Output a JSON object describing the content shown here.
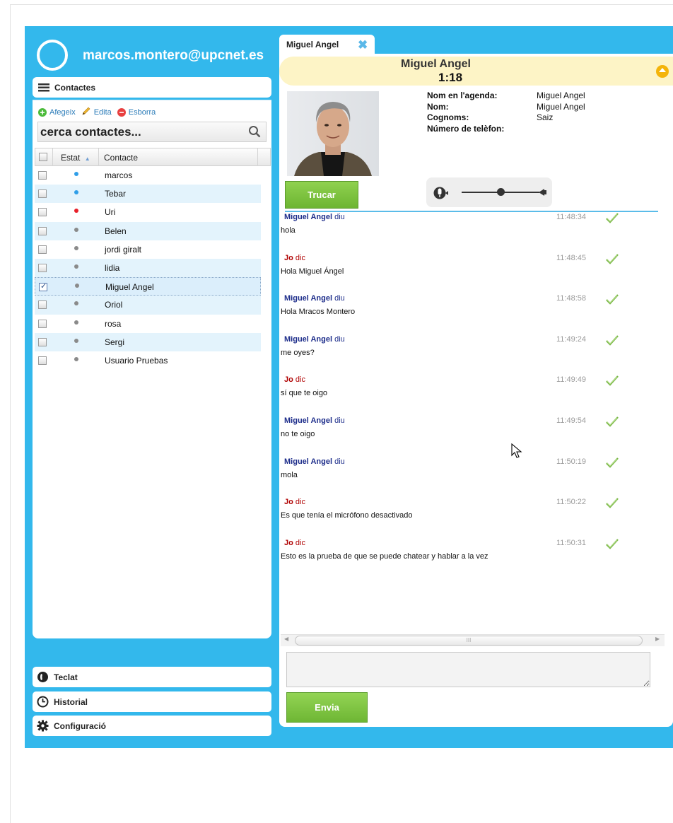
{
  "user": {
    "email": "marcos.montero@upcnet.es"
  },
  "contacts": {
    "header": "Contactes",
    "actions": {
      "add": "Afegeix",
      "edit": "Edita",
      "delete": "Esborra"
    },
    "search_placeholder": "cerca contactes...",
    "columns": {
      "status": "Estat",
      "contact": "Contacte"
    },
    "rows": [
      {
        "name": "marcos",
        "status_color": "#2f9ee8",
        "checked": false
      },
      {
        "name": "Tebar",
        "status_color": "#2f9ee8",
        "checked": false
      },
      {
        "name": "Uri",
        "status_color": "#e8202a",
        "checked": false
      },
      {
        "name": "Belen",
        "status_color": "#8a8a8a",
        "checked": false
      },
      {
        "name": "jordi giralt",
        "status_color": "#8a8a8a",
        "checked": false
      },
      {
        "name": "lidia",
        "status_color": "#8a8a8a",
        "checked": false
      },
      {
        "name": "Miguel Angel",
        "status_color": "#8a8a8a",
        "checked": true
      },
      {
        "name": "Oriol",
        "status_color": "#8a8a8a",
        "checked": false
      },
      {
        "name": "rosa",
        "status_color": "#8a8a8a",
        "checked": false
      },
      {
        "name": "Sergi",
        "status_color": "#8a8a8a",
        "checked": false
      },
      {
        "name": "Usuario Pruebas",
        "status_color": "#8a8a8a",
        "checked": false
      }
    ]
  },
  "bottom_nav": {
    "keypad": "Teclat",
    "history": "Historial",
    "settings": "Configuració"
  },
  "conversation": {
    "tab_label": "Miguel Angel",
    "call_name": "Miguel Angel",
    "call_time": "1:18",
    "info": {
      "agenda_label": "Nom en l'agenda:",
      "agenda_value": "Miguel Angel",
      "name_label": "Nom:",
      "name_value": "Miguel Angel",
      "surname_label": "Cognoms:",
      "surname_value": "Saiz",
      "phone_label": "Número de telèfon:",
      "phone_value": ""
    },
    "call_button": "Trucar",
    "volume_level": 0.5,
    "send_button": "Envia",
    "scroll_marker": "III",
    "messages": [
      {
        "sender": "Miguel Angel",
        "verb": "diu",
        "mine": false,
        "time": "11:48:34",
        "text": "hola"
      },
      {
        "sender": "Jo",
        "verb": "dic",
        "mine": true,
        "time": "11:48:45",
        "text": "Hola Miguel Ángel"
      },
      {
        "sender": "Miguel Angel",
        "verb": "diu",
        "mine": false,
        "time": "11:48:58",
        "text": "Hola Mracos Montero"
      },
      {
        "sender": "Miguel Angel",
        "verb": "diu",
        "mine": false,
        "time": "11:49:24",
        "text": "me oyes?"
      },
      {
        "sender": "Jo",
        "verb": "dic",
        "mine": true,
        "time": "11:49:49",
        "text": "sí que te oigo"
      },
      {
        "sender": "Miguel Angel",
        "verb": "diu",
        "mine": false,
        "time": "11:49:54",
        "text": "no te oigo"
      },
      {
        "sender": "Miguel Angel",
        "verb": "diu",
        "mine": false,
        "time": "11:50:19",
        "text": "mola"
      },
      {
        "sender": "Jo",
        "verb": "dic",
        "mine": true,
        "time": "11:50:22",
        "text": "Es que tenía el micrófono desactivado"
      },
      {
        "sender": "Jo",
        "verb": "dic",
        "mine": true,
        "time": "11:50:31",
        "text": "Esto es la prueba de que se puede chatear y hablar a la vez"
      }
    ]
  }
}
